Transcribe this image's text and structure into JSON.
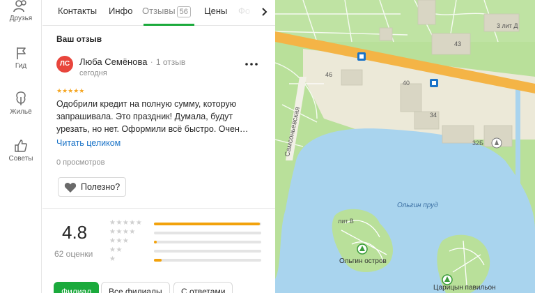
{
  "rail": {
    "items": [
      {
        "label": "Друзья",
        "icon": "friends-icon"
      },
      {
        "label": "Гид",
        "icon": "flag-icon"
      },
      {
        "label": "Жильё",
        "icon": "building-icon"
      },
      {
        "label": "Советы",
        "icon": "thumbs-up-icon"
      }
    ]
  },
  "tabs": {
    "items": [
      {
        "label": "Контакты"
      },
      {
        "label": "Инфо"
      },
      {
        "label": "Отзывы",
        "count": "56"
      },
      {
        "label": "Цены"
      },
      {
        "label": "Фо"
      }
    ],
    "active_index": 2
  },
  "review": {
    "section_title": "Ваш отзыв",
    "avatar_initials": "ЛС",
    "author": "Люба Семёнова",
    "author_reviews": "1 отзыв",
    "date": "сегодня",
    "stars": "★★★★★",
    "text": "Одобрили кредит на полную сумму, которую запрашивала. Это праздник! Думала, будут урезать, но нет. Оформили всё быстро. Очен…",
    "read_more": "Читать целиком",
    "views": "0 просмотров",
    "useful_label": "Полезно?"
  },
  "rating": {
    "value": "4.8",
    "count_label": "62 оценки",
    "distribution": [
      {
        "stars": 5,
        "stars_text": "★★★★★",
        "fraction": 0.99
      },
      {
        "stars": 4,
        "stars_text": "★★★★",
        "fraction": 0.0
      },
      {
        "stars": 3,
        "stars_text": "★★★",
        "fraction": 0.015
      },
      {
        "stars": 2,
        "stars_text": "★★",
        "fraction": 0.0
      },
      {
        "stars": 1,
        "stars_text": "★",
        "fraction": 0.07
      }
    ]
  },
  "filters": [
    {
      "label": "Филиал",
      "active": true
    },
    {
      "label": "Все филиалы",
      "active": false
    },
    {
      "label": "С ответами",
      "active": false
    }
  ],
  "map": {
    "labels": {
      "street": "Самсоньевская",
      "pond": "Ольгин пруд",
      "island": "Ольгин остров",
      "pavilion": "Царицын павильон",
      "lit_b": "лит В",
      "lit_d": "3 лит Д",
      "n43": "43",
      "n46": "46",
      "n40": "40",
      "n34": "34",
      "n32b": "32Б"
    }
  },
  "colors": {
    "accent_green": "#1baa3c",
    "star_orange": "#f2a20c",
    "link_blue": "#1a73c7",
    "avatar_red": "#e8453c",
    "map_water": "#a9d4ee",
    "map_park": "#b9e09a",
    "map_road": "#f4b446"
  }
}
